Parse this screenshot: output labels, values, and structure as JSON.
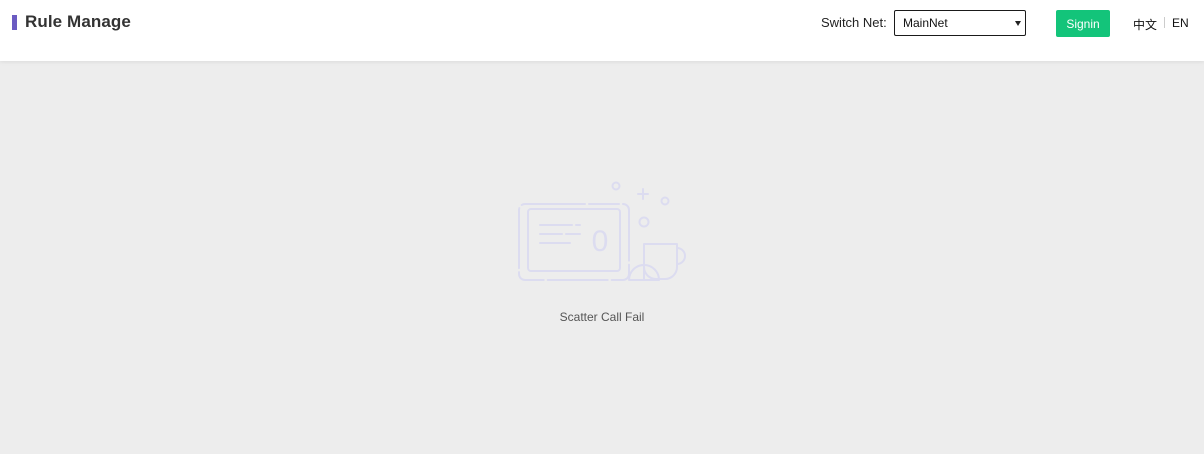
{
  "header": {
    "title": "Rule Manage",
    "switch_net_label": "Switch Net:",
    "net_select": {
      "selected": "MainNet"
    },
    "signin_label": "Signin",
    "lang_zh": "中文",
    "lang_en": "EN"
  },
  "main": {
    "empty_message": "Scatter Call Fail",
    "illustration_digit": "0"
  },
  "colors": {
    "brand_accent": "#6b5bc2",
    "signin": "#13c47a",
    "background": "#ededed"
  }
}
